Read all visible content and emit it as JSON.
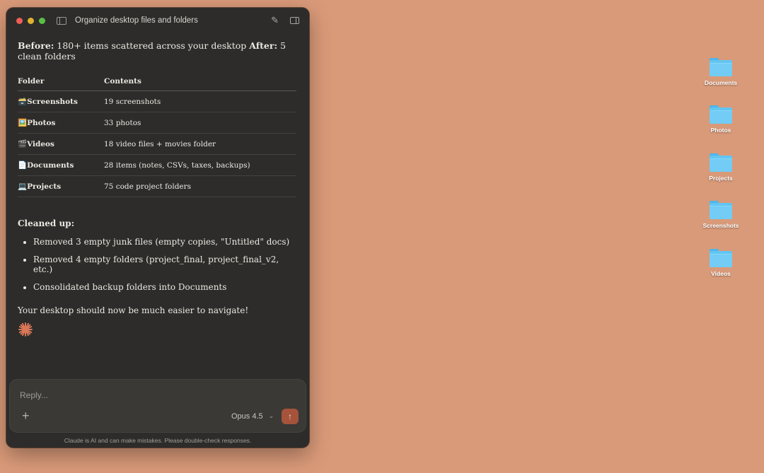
{
  "window": {
    "title": "Organize desktop files and folders",
    "icons": {
      "sidebar": "sidebar-toggle-icon",
      "tools": "tools-icon",
      "panel": "panel-icon"
    }
  },
  "message": {
    "before_label": "Before:",
    "before_text": "180+ items scattered across your desktop",
    "after_label": "After:",
    "after_text": "5 clean folders",
    "table": {
      "headers": [
        "Folder",
        "Contents"
      ],
      "rows": [
        {
          "emoji": "🗃️",
          "folder": "Screenshots",
          "contents": "19 screenshots"
        },
        {
          "emoji": "🖼️",
          "folder": "Photos",
          "contents": "33 photos"
        },
        {
          "emoji": "🎬",
          "folder": "Videos",
          "contents": "18 video files + movies folder"
        },
        {
          "emoji": "📄",
          "folder": "Documents",
          "contents": "28 items (notes, CSVs, taxes, backups)"
        },
        {
          "emoji": "💻",
          "folder": "Projects",
          "contents": "75 code project folders"
        }
      ]
    },
    "cleaned_heading": "Cleaned up:",
    "cleaned_items": [
      "Removed 3 empty junk files (empty copies, \"Untitled\" docs)",
      "Removed 4 empty folders (project_final, project_final_v2, etc.)",
      "Consolidated backup folders into Documents"
    ],
    "closing": "Your desktop should now be much easier to navigate!"
  },
  "composer": {
    "placeholder": "Reply...",
    "model": "Opus 4.5",
    "send_icon": "arrow-up-icon"
  },
  "disclaimer": "Claude is AI and can make mistakes. Please double-check responses.",
  "desktop": {
    "folders": [
      "Documents",
      "Photos",
      "Projects",
      "Screenshots",
      "Videos"
    ]
  },
  "colors": {
    "desktop_bg": "#d99a79",
    "window_bg": "#2d2c2a",
    "accent_send": "#a5533a",
    "folder_blue": "#62c5f2",
    "spark": "#d97757"
  }
}
